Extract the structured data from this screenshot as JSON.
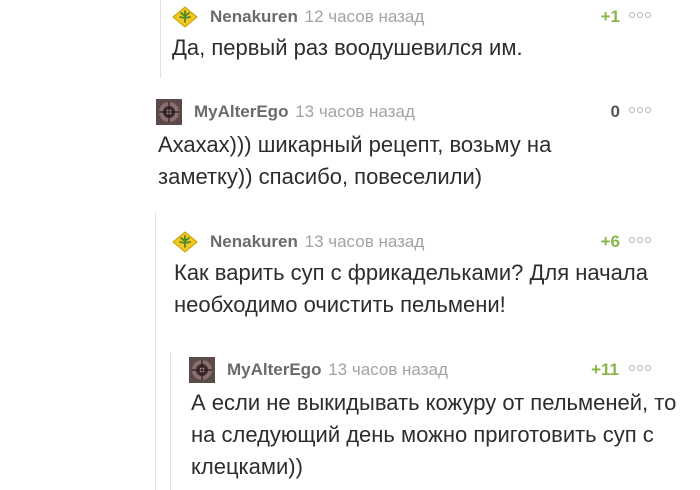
{
  "comments": [
    {
      "author": "Nenakuren",
      "time": "12 часов назад",
      "rating": "+1",
      "text": "Да, первый раз воодушевился им.",
      "avatar_icon": "leaf-badge-icon"
    },
    {
      "author": "MyAlterEgo",
      "time": "13 часов назад",
      "rating": "0",
      "text": "Ахахах))) шикарный рецепт, возьму на заметку)) спасибо, повеселили)",
      "avatar_icon": "dark-circle-avatar"
    },
    {
      "author": "Nenakuren",
      "time": "13 часов назад",
      "rating": "+6",
      "text": "Как варить  суп с фрикадельками?  Для начала необходимо очистить пельмени!",
      "avatar_icon": "leaf-badge-icon"
    },
    {
      "author": "MyAlterEgo",
      "time": "13 часов назад",
      "rating": "+11",
      "text": "А если не выкидывать кожуру от пельменей, то на следующий день можно приготовить суп с клецками))",
      "avatar_icon": "dark-circle-avatar"
    }
  ],
  "colors": {
    "positive_rating": "#8ab54a",
    "author": "#6b6b6b",
    "time": "#a3a3a3",
    "badge_yellow": "#f3c81f",
    "leaf_green": "#4e8a2a"
  }
}
